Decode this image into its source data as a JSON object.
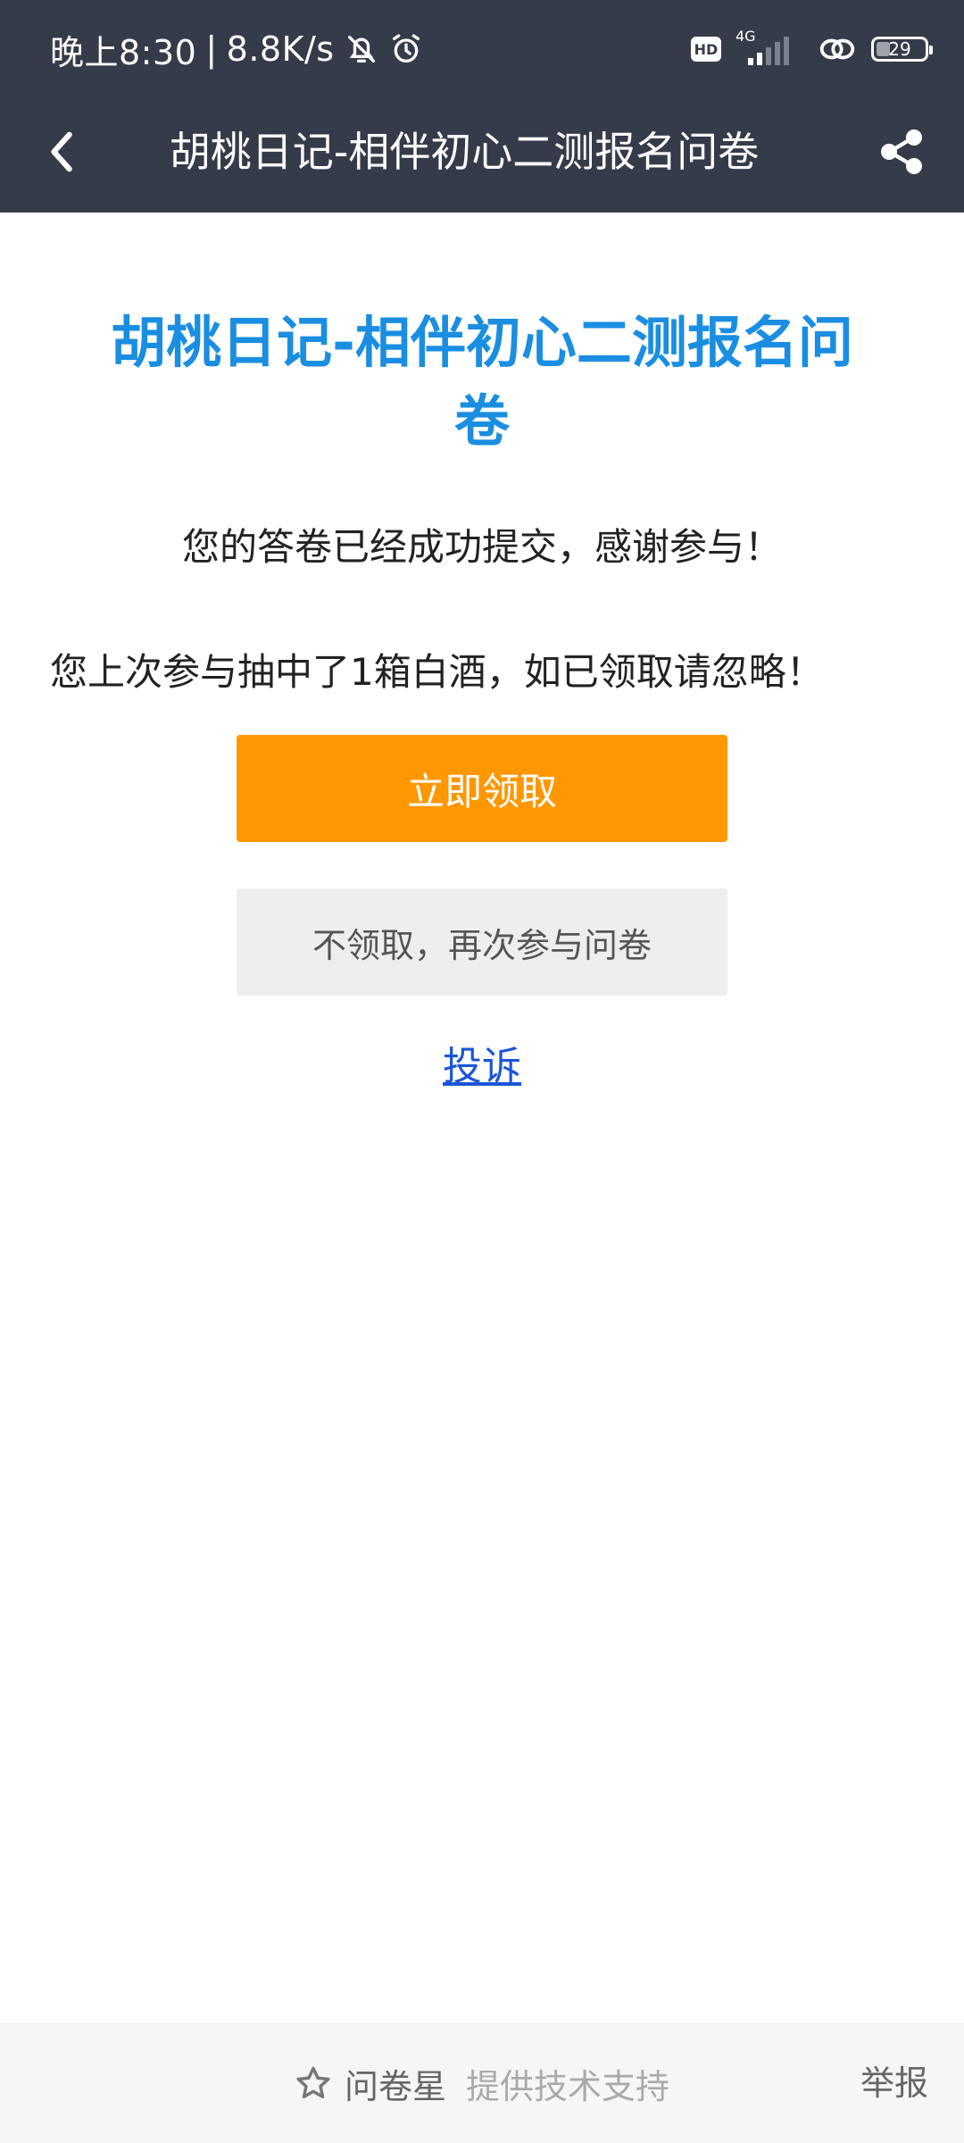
{
  "status_bar": {
    "time": "晚上8:30",
    "separator": "|",
    "net_speed": "8.8K/s",
    "hd_label": "HD",
    "network_type": "4G",
    "battery_level": "29"
  },
  "header": {
    "title": "胡桃日记-相伴初心二测报名问卷"
  },
  "main": {
    "heading": "胡桃日记-相伴初心二测报名问卷",
    "success_message": "您的答卷已经成功提交，感谢参与！",
    "prize_message": "您上次参与抽中了1箱白酒，如已领取请忽略！",
    "claim_button": "立即领取",
    "retake_button": "不领取，再次参与问卷",
    "complain_link": "投诉"
  },
  "footer": {
    "brand_name": "问卷星",
    "brand_tagline": "提供技术支持",
    "report_link": "举报"
  },
  "colors": {
    "header_bg": "#363b49",
    "heading": "#1a8ee1",
    "claim_button": "#ff9700",
    "link": "#1a55d6"
  }
}
